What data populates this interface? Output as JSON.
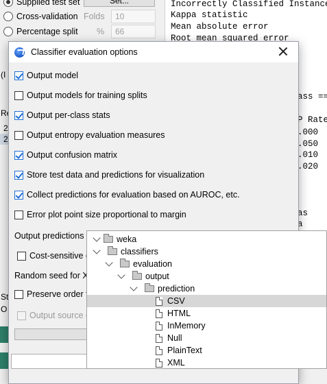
{
  "background": {
    "test_options": {
      "supplied_test_set": "Supplied test set",
      "set_button": "Set...",
      "cross_validation": "Cross-validation",
      "folds_label": "Folds",
      "folds_value": "10",
      "percentage_split": "Percentage split",
      "percent_label": "%",
      "percent_value": "66"
    },
    "left_edge": {
      "paren": "(I",
      "result_label": "Re",
      "row1": "2",
      "row2": "2",
      "st": "St",
      "o": "O"
    },
    "output": {
      "lines": [
        "Incorrectly Classified Instances",
        "Kappa statistic",
        "Mean absolute error",
        "Root mean squared error"
      ],
      "class_fragment": "ass ==",
      "rate_header": "P Rate",
      "rates": [
        ".000",
        ".050",
        ".010",
        ".020"
      ],
      "as_fragment": "as",
      "a_fragment": "a"
    }
  },
  "dialog": {
    "title": "Classifier evaluation options",
    "options": [
      {
        "label": "Output model",
        "checked": true
      },
      {
        "label": "Output models for training splits",
        "checked": false
      },
      {
        "label": "Output per-class stats",
        "checked": true
      },
      {
        "label": "Output entropy evaluation measures",
        "checked": false
      },
      {
        "label": "Output confusion matrix",
        "checked": true
      },
      {
        "label": "Store test data and predictions for visualization",
        "checked": true
      },
      {
        "label": "Collect predictions for evaluation based on AUROC, etc.",
        "checked": true
      },
      {
        "label": "Error plot point size proportional to margin",
        "checked": false
      }
    ],
    "output_predictions_label": "Output predictions",
    "cost_sensitive_label": "Cost-sensitive e",
    "random_seed_label": "Random seed for XV",
    "preserve_order_label": "Preserve order fo",
    "output_source_label": "Output source c"
  },
  "tree": {
    "nodes": [
      {
        "label": "weka",
        "type": "folder",
        "level": 0,
        "expanded": true
      },
      {
        "label": "classifiers",
        "type": "folder",
        "level": 1,
        "expanded": true
      },
      {
        "label": "evaluation",
        "type": "folder",
        "level": 2,
        "expanded": true
      },
      {
        "label": "output",
        "type": "folder",
        "level": 3,
        "expanded": true
      },
      {
        "label": "prediction",
        "type": "folder",
        "level": 4,
        "expanded": true
      },
      {
        "label": "CSV",
        "type": "file",
        "level": 5,
        "selected": true
      },
      {
        "label": "HTML",
        "type": "file",
        "level": 5
      },
      {
        "label": "InMemory",
        "type": "file",
        "level": 5
      },
      {
        "label": "Null",
        "type": "file",
        "level": 5
      },
      {
        "label": "PlainText",
        "type": "file",
        "level": 5
      },
      {
        "label": "XML",
        "type": "file",
        "level": 5
      }
    ]
  }
}
